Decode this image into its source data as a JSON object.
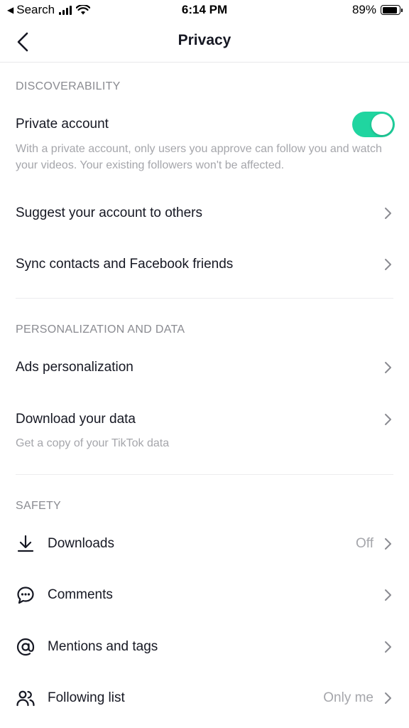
{
  "status_bar": {
    "back_app": "Search",
    "time": "6:14 PM",
    "battery": "89%",
    "battery_level": 0.89
  },
  "nav": {
    "title": "Privacy",
    "back_icon": "chevron-left-icon"
  },
  "discoverability": {
    "header": "DISCOVERABILITY",
    "private_account": {
      "label": "Private account",
      "description": "With a private account, only users you approve can follow you and watch your videos. Your existing followers won't be affected.",
      "toggle_on": true,
      "toggle_color": "#20d5a0"
    },
    "suggest_label": "Suggest your account to others",
    "sync_label": "Sync contacts and Facebook friends"
  },
  "personalization": {
    "header": "PERSONALIZATION AND DATA",
    "ads_label": "Ads personalization",
    "download_label": "Download your data",
    "download_desc": "Get a copy of your TikTok data"
  },
  "safety": {
    "header": "SAFETY",
    "downloads": {
      "label": "Downloads",
      "value": "Off",
      "icon": "download-icon"
    },
    "comments": {
      "label": "Comments",
      "icon": "comment-icon"
    },
    "mentions": {
      "label": "Mentions and tags",
      "icon": "at-sign-icon"
    },
    "following": {
      "label": "Following list",
      "value": "Only me",
      "icon": "people-icon"
    }
  }
}
